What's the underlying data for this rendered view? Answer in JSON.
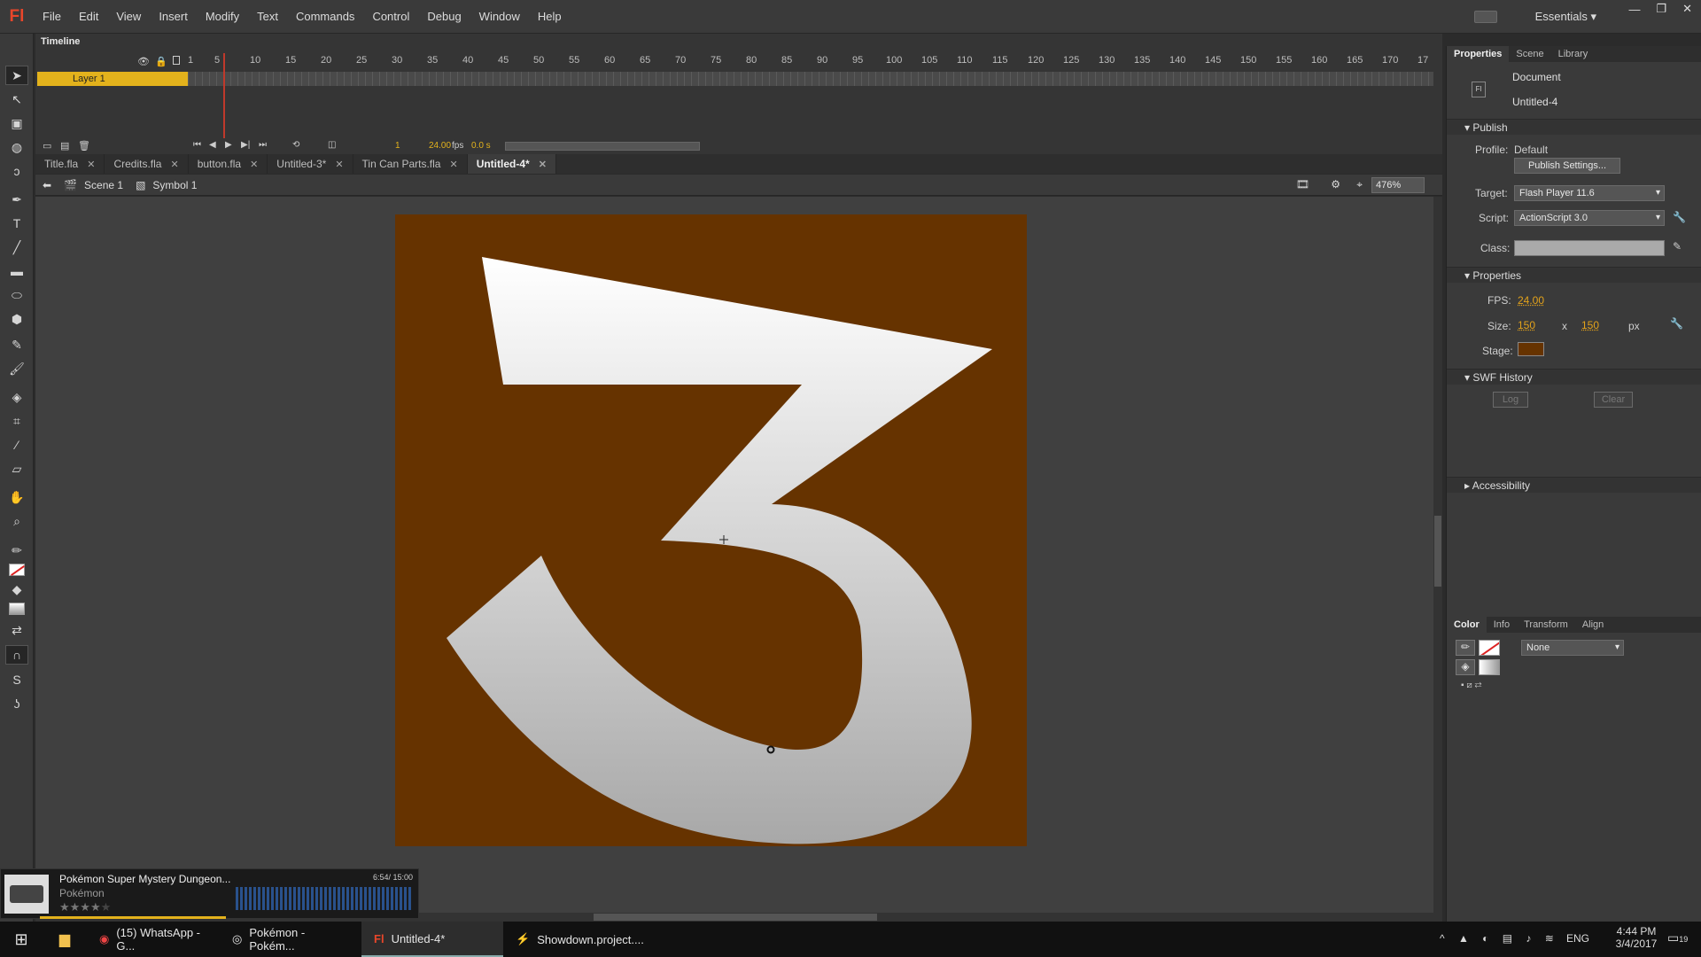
{
  "app": {
    "logo": "Fl",
    "menu": [
      "File",
      "Edit",
      "View",
      "Insert",
      "Modify",
      "Text",
      "Commands",
      "Control",
      "Debug",
      "Window",
      "Help"
    ],
    "workspace": "Essentials"
  },
  "timeline": {
    "tab": "Timeline",
    "ruler": [
      "1",
      "5",
      "10",
      "15",
      "20",
      "25",
      "30",
      "35",
      "40",
      "45",
      "50",
      "55",
      "60",
      "65",
      "70",
      "75",
      "80",
      "85",
      "90",
      "95",
      "100",
      "105",
      "110",
      "115",
      "120",
      "125",
      "130",
      "135",
      "140",
      "145",
      "150",
      "155",
      "160",
      "165",
      "170",
      "17"
    ],
    "layer": "Layer 1",
    "current_frame": "1",
    "fps": "24.00",
    "fps_unit": "fps",
    "time": "0.0 s"
  },
  "doc_tabs": [
    {
      "name": "Title.fla",
      "active": false
    },
    {
      "name": "Credits.fla",
      "active": false
    },
    {
      "name": "button.fla",
      "active": false
    },
    {
      "name": "Untitled-3*",
      "active": false
    },
    {
      "name": "Tin Can Parts.fla",
      "active": false
    },
    {
      "name": "Untitled-4*",
      "active": true
    }
  ],
  "editbar": {
    "scene": "Scene 1",
    "symbol": "Symbol 1",
    "zoom": "476%"
  },
  "stage": {
    "color": "#663300",
    "glyph": "3"
  },
  "properties": {
    "tabs": [
      "Properties",
      "Scene",
      "Library"
    ],
    "doc_type": "Document",
    "doc_name": "Untitled-4",
    "publish_header": "Publish",
    "profile_label": "Profile:",
    "profile_value": "Default",
    "publish_settings": "Publish Settings...",
    "target_label": "Target:",
    "target_value": "Flash Player 11.6",
    "script_label": "Script:",
    "script_value": "ActionScript 3.0",
    "class_label": "Class:",
    "props_header": "Properties",
    "fps_label": "FPS:",
    "fps_value": "24.00",
    "size_label": "Size:",
    "width": "150",
    "x_sep": "x",
    "height": "150",
    "unit": "px",
    "stage_label": "Stage:",
    "swf_header": "SWF History",
    "log": "Log",
    "clear": "Clear",
    "accessibility": "Accessibility"
  },
  "color_panel": {
    "tabs": [
      "Color",
      "Info",
      "Transform",
      "Align"
    ],
    "fill_type": "None"
  },
  "music": {
    "title": "Pokémon Super Mystery Dungeon...",
    "artist": "Pokémon",
    "time": "6:54/ 15:00",
    "rating": 4,
    "rating_max": 5
  },
  "taskbar": {
    "items": [
      {
        "label": "(15) WhatsApp - G...",
        "icon": "chrome-icon"
      },
      {
        "label": "Pokémon - Pokém...",
        "icon": "media-player-icon"
      },
      {
        "label": "Untitled-4*",
        "icon": "flash-icon",
        "active": true
      },
      {
        "label": "Showdown.project....",
        "icon": "editor-icon"
      }
    ],
    "lang": "ENG",
    "time": "4:44 PM",
    "date": "3/4/2017",
    "notifications": "19"
  }
}
